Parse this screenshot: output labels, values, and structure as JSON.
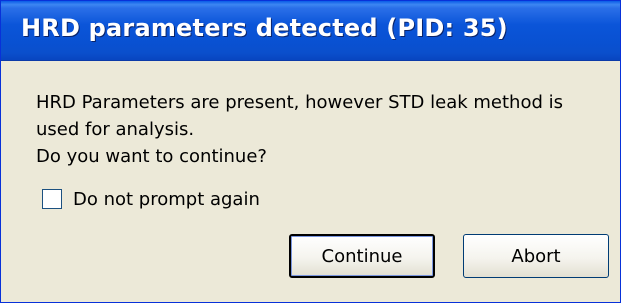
{
  "dialog": {
    "title": "HRD parameters detected (PID: 35)",
    "message_lines": [
      "HRD Parameters are present, however STD leak method is",
      "used for analysis.",
      "Do you want to continue?"
    ],
    "checkbox": {
      "label": "Do not prompt again",
      "checked": false
    },
    "buttons": {
      "continue": "Continue",
      "abort": "Abort"
    }
  },
  "colors": {
    "titlebar": "#0b55d9",
    "dialog_background": "#ece9d8",
    "title_text": "#ffffff"
  }
}
